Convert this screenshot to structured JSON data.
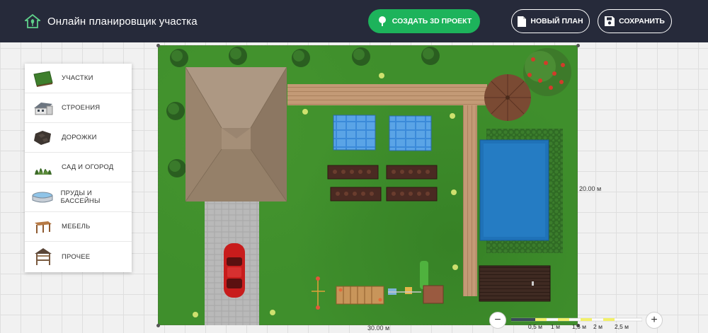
{
  "header": {
    "title": "Онлайн планировщик участка",
    "create_3d_label": "СОЗДАТЬ 3D ПРОЕКТ",
    "new_plan_label": "НОВЫЙ ПЛАН",
    "save_label": "СОХРАНИТЬ"
  },
  "sidebar": {
    "items": [
      {
        "label": "УЧАСТКИ",
        "icon": "lawn-icon"
      },
      {
        "label": "СТРОЕНИЯ",
        "icon": "house-icon"
      },
      {
        "label": "ДОРОЖКИ",
        "icon": "paving-icon"
      },
      {
        "label": "САД И ОГОРОД",
        "icon": "shrub-icon"
      },
      {
        "label": "ПРУДЫ И БАССЕЙНЫ",
        "icon": "pool-icon"
      },
      {
        "label": "МЕБЕЛЬ",
        "icon": "table-icon"
      },
      {
        "label": "ПРОЧЕЕ",
        "icon": "gazebo-icon"
      }
    ]
  },
  "plot": {
    "width_label": "30.00 м",
    "height_label": "20.00 м"
  },
  "zoom": {
    "scale_labels": [
      "0,5 м",
      "1 м",
      "1,5 м",
      "2 м",
      "2,5 м"
    ],
    "zoom_out": "−",
    "zoom_in": "+"
  },
  "colors": {
    "header_bg": "#262a3a",
    "accent_green": "#1db35b",
    "grass": "#3f8f2c",
    "water": "#1f72b8"
  }
}
